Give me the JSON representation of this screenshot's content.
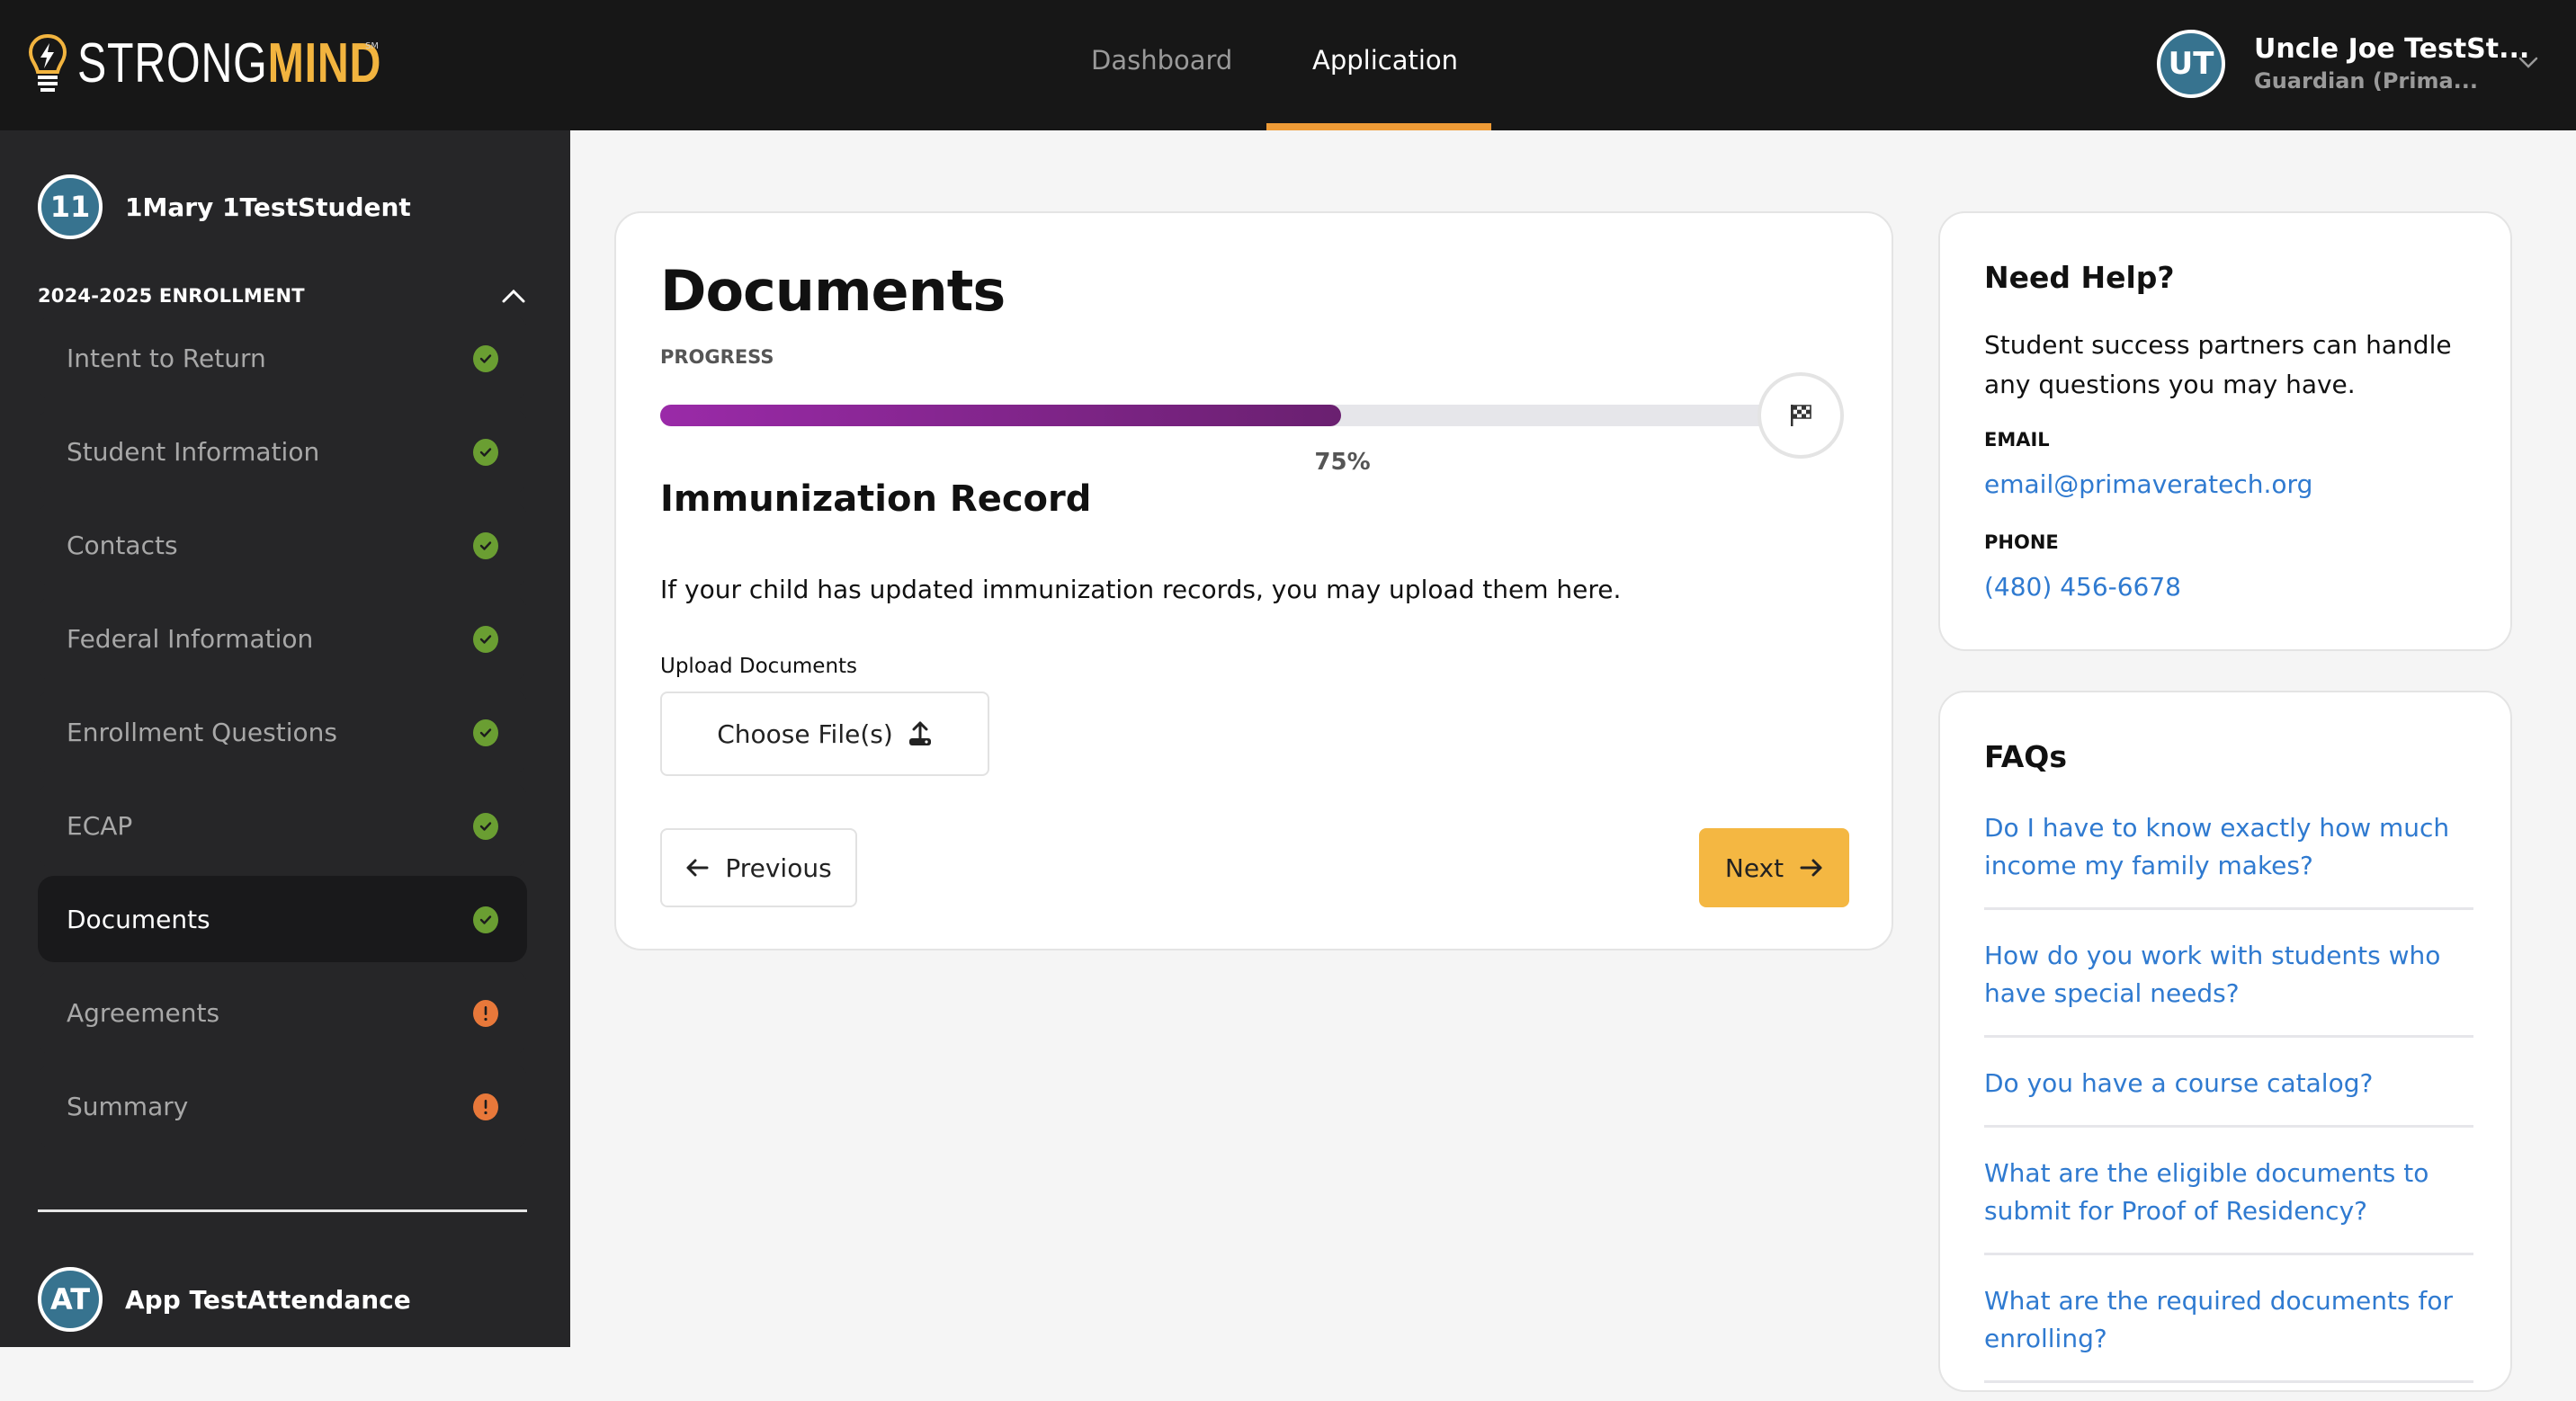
{
  "header": {
    "logo": {
      "strong": "STRONG",
      "mind": "MIND",
      "mark": "SM"
    },
    "nav": [
      {
        "label": "Dashboard",
        "active": false
      },
      {
        "label": "Application",
        "active": true
      }
    ],
    "user": {
      "initials": "UT",
      "name": "Uncle Joe TestSt...",
      "role": "Guardian (Prima..."
    }
  },
  "sidebar": {
    "student": {
      "initials": "11",
      "name": "1Mary 1TestStudent"
    },
    "enrollment_title": "2024-2025 ENROLLMENT",
    "steps": [
      {
        "label": "Intent to Return",
        "status": "complete"
      },
      {
        "label": "Student Information",
        "status": "complete"
      },
      {
        "label": "Contacts",
        "status": "complete"
      },
      {
        "label": "Federal Information",
        "status": "complete"
      },
      {
        "label": "Enrollment Questions",
        "status": "complete"
      },
      {
        "label": "ECAP",
        "status": "complete"
      },
      {
        "label": "Documents",
        "status": "complete",
        "active": true
      },
      {
        "label": "Agreements",
        "status": "warning"
      },
      {
        "label": "Summary",
        "status": "warning"
      }
    ],
    "second_student": {
      "initials": "AT",
      "name": "App TestAttendance"
    }
  },
  "main": {
    "title": "Documents",
    "progress_label": "PROGRESS",
    "progress_percent": 75,
    "progress_text": "75%",
    "section_title": "Immunization Record",
    "section_description": "If your child has updated immunization records, you may upload them here.",
    "upload_label": "Upload Documents",
    "choose_files_label": "Choose File(s)",
    "previous_label": "Previous",
    "next_label": "Next"
  },
  "help": {
    "title": "Need Help?",
    "description": "Student success partners can handle any questions you may have.",
    "email_label": "EMAIL",
    "email": "email@primaveratech.org",
    "phone_label": "PHONE",
    "phone": "(480) 456-6678"
  },
  "faqs": {
    "title": "FAQs",
    "items": [
      "Do I have to know exactly how much income my family makes?",
      "How do you work with students who have special needs?",
      "Do you have a course catalog?",
      "What are the eligible documents to submit for Proof of Residency?",
      "What are the required documents for enrolling?"
    ]
  },
  "colors": {
    "accent_orange": "#ee9b36",
    "next_button": "#f4b742",
    "link_blue": "#2f7ad0",
    "avatar_teal": "#37738f",
    "status_complete": "#6a9e32",
    "status_warning": "#e8783a",
    "progress_start": "#9a2aa8",
    "progress_end": "#6a2070"
  }
}
